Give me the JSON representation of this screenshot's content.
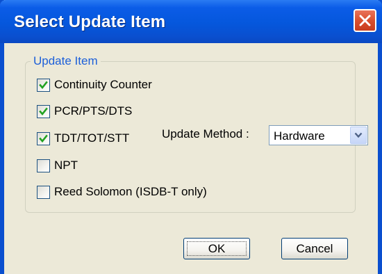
{
  "window": {
    "title": "Select Update Item"
  },
  "group": {
    "label": "Update Item"
  },
  "items": [
    {
      "label": "Continuity Counter",
      "checked": true
    },
    {
      "label": "PCR/PTS/DTS",
      "checked": true
    },
    {
      "label": "TDT/TOT/STT",
      "checked": true
    },
    {
      "label": "NPT",
      "checked": false
    },
    {
      "label": "Reed Solomon (ISDB-T only)",
      "checked": false
    }
  ],
  "update_method": {
    "label": "Update Method :",
    "value": "Hardware"
  },
  "buttons": {
    "ok": "OK",
    "cancel": "Cancel"
  },
  "colors": {
    "title_bar": "#0a4fcf",
    "close_button": "#d9502f",
    "group_label": "#1c5fd9",
    "checkmark": "#21a121",
    "dialog_background": "#ece9d8"
  }
}
